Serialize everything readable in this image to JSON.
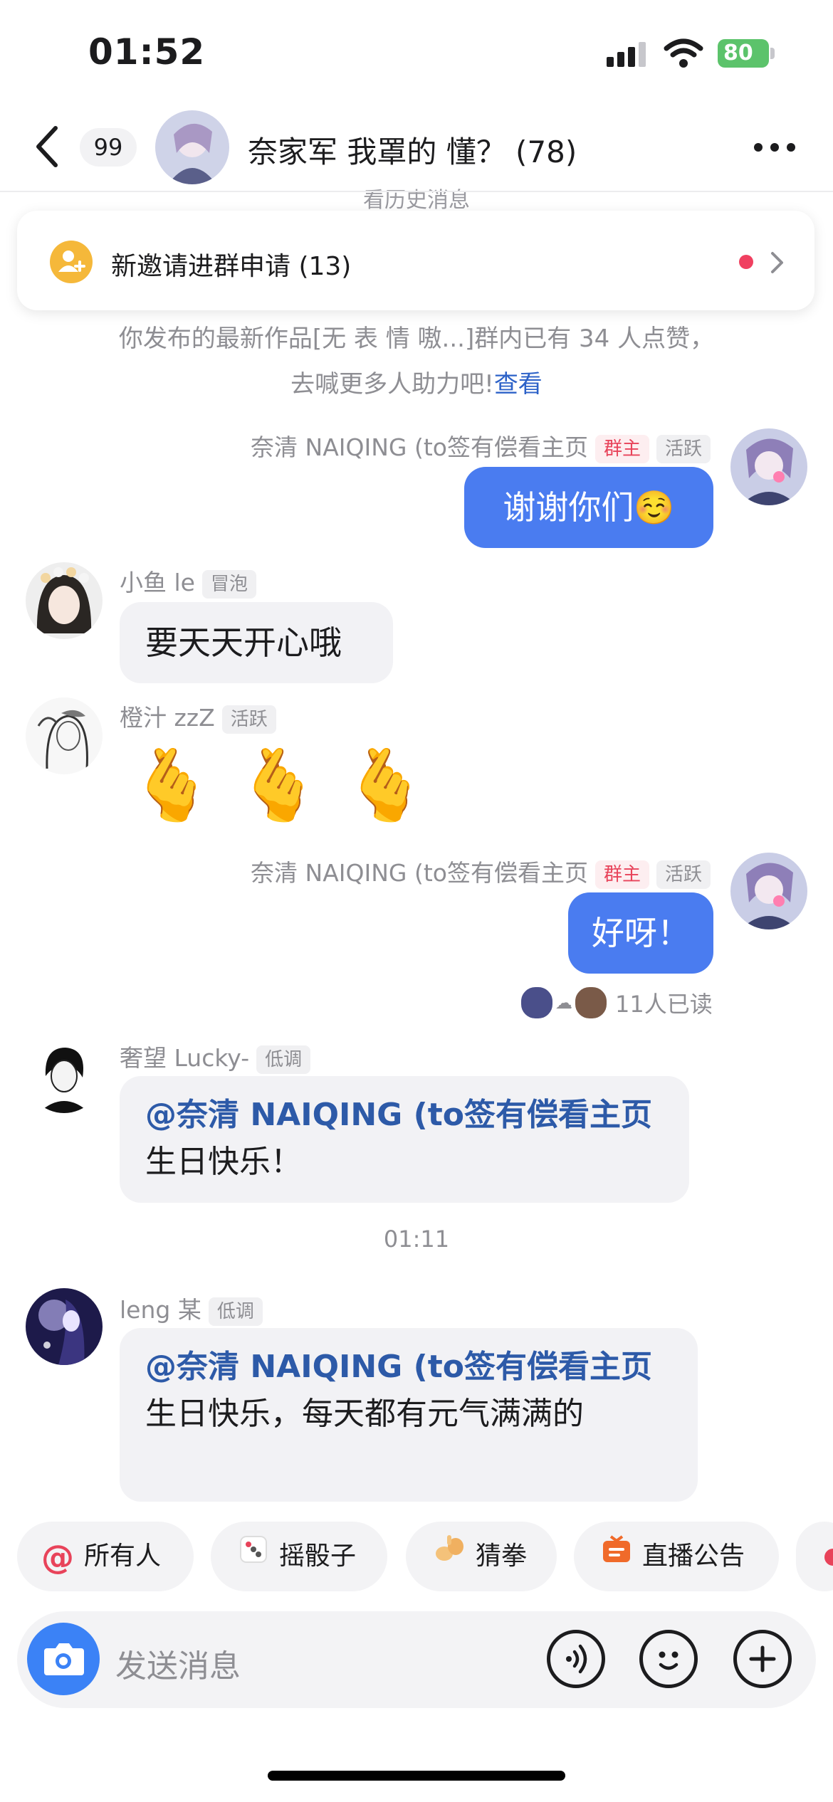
{
  "status_bar": {
    "time": "01:52",
    "battery": "80"
  },
  "nav": {
    "unread_count": "99",
    "title": "奈家军 我罩的 懂？ (78)"
  },
  "history_peek": "看历史消息",
  "invite": {
    "text": "新邀请进群申请 (13)"
  },
  "notice": {
    "line1": "你发布的最新作品[无 表 情 嗷...]群内已有 34 人点赞，",
    "line2_prefix": "去喊更多人助力吧!",
    "link": "查看"
  },
  "messages": [
    {
      "sender": "奈清 NAIQING (to签有偿看主页",
      "tags": [
        "群主",
        "活跃"
      ],
      "text": "谢谢你们☺️"
    },
    {
      "sender": "小鱼 le",
      "tags": [
        "冒泡"
      ],
      "text": "要天天开心哦"
    },
    {
      "sender": "橙汁 zzZ",
      "tags": [
        "活跃"
      ],
      "text": "🫰🫰🫰"
    },
    {
      "sender": "奈清 NAIQING (to签有偿看主页",
      "tags": [
        "群主",
        "活跃"
      ],
      "text": "好呀！"
    },
    {
      "sender": "奢望 Lucky-",
      "tags": [
        "低调"
      ],
      "mention": "@奈清 NAIQING (to签有偿看主页",
      "text": " 生日快乐！"
    },
    {
      "sender": "leng 某",
      "tags": [
        "低调"
      ],
      "mention": "@奈清 NAIQING (to签有偿看主页",
      "text": " 生日快乐，每天都有元气满满的"
    }
  ],
  "read_receipt": "11人已读",
  "timestamp": "01:11",
  "quick_actions": [
    {
      "label": "所有人",
      "icon": "at-icon"
    },
    {
      "label": "摇骰子",
      "icon": "dice-icon"
    },
    {
      "label": "猜拳",
      "icon": "rock-paper-scissors-icon"
    },
    {
      "label": "直播公告",
      "icon": "broadcast-icon"
    }
  ],
  "input": {
    "placeholder": "发送消息"
  },
  "colors": {
    "accent": "#4a7cf0",
    "owner_tag": "#e8435a",
    "mention": "#2d5aa8"
  }
}
